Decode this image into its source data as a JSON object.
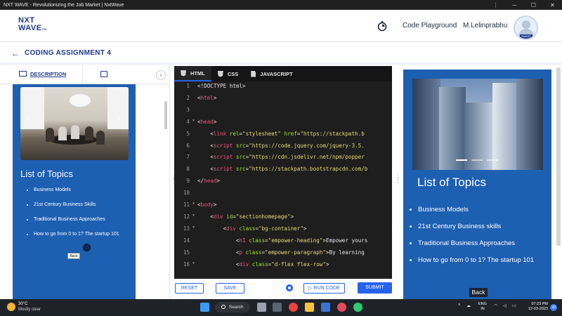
{
  "window": {
    "title": "NXT WAVE - Revolutionizing the Job Market | NxtWave",
    "controls": {
      "more": "⋮",
      "minimize": "─",
      "maximize": "☐",
      "close": "✕"
    }
  },
  "header": {
    "logo_line1": "NXT",
    "logo_line2": "WAVE",
    "logo_tm": "TM",
    "code_playground": "Code Playground",
    "user_name": "M.Lelinprabhu",
    "avatar_tag": "SMART"
  },
  "assignment": {
    "back_icon": "arrow-left-icon",
    "title": "CODING ASSIGNMENT 4"
  },
  "left_panel": {
    "tab_description": "DESCRIPTION",
    "collapse_icon": "‹",
    "preview": {
      "heading": "List of Topics",
      "topics": [
        "Business Models",
        "21st Century Business Skills",
        "Traditional Business Approaches",
        "How to go from 0 to 1? The startup 101"
      ],
      "back_button": "Back"
    }
  },
  "editor": {
    "tabs": [
      "HTML",
      "CSS",
      "JAVASCRIPT"
    ],
    "active_tab": "HTML",
    "lines": [
      {
        "n": "1",
        "fold": false,
        "tokens": [
          [
            "t",
            "<!DOCTYPE html>",
            "pun"
          ]
        ]
      },
      {
        "n": "2",
        "fold": false,
        "tokens": [
          [
            "t",
            "<",
            "pun"
          ],
          [
            "t",
            "html",
            "tag"
          ],
          [
            "t",
            ">",
            "pun"
          ]
        ]
      },
      {
        "n": "3",
        "fold": false,
        "tokens": []
      },
      {
        "n": "4",
        "fold": true,
        "tokens": [
          [
            "t",
            "<",
            "pun"
          ],
          [
            "t",
            "head",
            "tag"
          ],
          [
            "t",
            ">",
            "pun"
          ]
        ]
      },
      {
        "n": "5",
        "fold": false,
        "indent": "    ",
        "tokens": [
          [
            "t",
            "<",
            "pun"
          ],
          [
            "t",
            "link",
            "tag"
          ],
          [
            "t",
            " rel",
            "attr"
          ],
          [
            "t",
            "=",
            "pun"
          ],
          [
            "t",
            "\"stylesheet\"",
            "str"
          ],
          [
            "t",
            " href",
            "attr"
          ],
          [
            "t",
            "=",
            "pun"
          ],
          [
            "t",
            "\"https://stackpath.b",
            "str"
          ]
        ]
      },
      {
        "n": "6",
        "fold": false,
        "indent": "    ",
        "tokens": [
          [
            "t",
            "<",
            "pun"
          ],
          [
            "t",
            "script",
            "tag"
          ],
          [
            "t",
            " src",
            "attr"
          ],
          [
            "t",
            "=",
            "pun"
          ],
          [
            "t",
            "\"https://code.jquery.com/jquery-3.5.",
            "str"
          ]
        ]
      },
      {
        "n": "7",
        "fold": false,
        "indent": "    ",
        "tokens": [
          [
            "t",
            "<",
            "pun"
          ],
          [
            "t",
            "script",
            "tag"
          ],
          [
            "t",
            " src",
            "attr"
          ],
          [
            "t",
            "=",
            "pun"
          ],
          [
            "t",
            "\"https://cdn.jsdelivr.net/npm/popper",
            "str"
          ]
        ]
      },
      {
        "n": "8",
        "fold": false,
        "indent": "    ",
        "tokens": [
          [
            "t",
            "<",
            "pun"
          ],
          [
            "t",
            "script",
            "tag"
          ],
          [
            "t",
            " src",
            "attr"
          ],
          [
            "t",
            "=",
            "pun"
          ],
          [
            "t",
            "\"https://stackpath.bootstrapcdn.com/b",
            "str"
          ]
        ]
      },
      {
        "n": "9",
        "fold": false,
        "tokens": [
          [
            "t",
            "</",
            "pun"
          ],
          [
            "t",
            "head",
            "tag"
          ],
          [
            "t",
            ">",
            "pun"
          ]
        ]
      },
      {
        "n": "10",
        "fold": false,
        "tokens": []
      },
      {
        "n": "11",
        "fold": true,
        "tokens": [
          [
            "t",
            "<",
            "pun"
          ],
          [
            "t",
            "body",
            "tag"
          ],
          [
            "t",
            ">",
            "pun"
          ]
        ]
      },
      {
        "n": "12",
        "fold": true,
        "indent": "    ",
        "tokens": [
          [
            "t",
            "<",
            "pun"
          ],
          [
            "t",
            "div",
            "tag"
          ],
          [
            "t",
            " id",
            "attr"
          ],
          [
            "t",
            "=",
            "pun"
          ],
          [
            "t",
            "\"sectionhomepage\"",
            "str"
          ],
          [
            "t",
            ">",
            "pun"
          ]
        ]
      },
      {
        "n": "13",
        "fold": true,
        "indent": "        ",
        "tokens": [
          [
            "t",
            "<",
            "pun"
          ],
          [
            "t",
            "div",
            "tag"
          ],
          [
            "t",
            " class",
            "attr"
          ],
          [
            "t",
            "=",
            "pun"
          ],
          [
            "t",
            "\"bg-container\"",
            "str"
          ],
          [
            "t",
            ">",
            "pun"
          ]
        ]
      },
      {
        "n": "14",
        "fold": false,
        "indent": "            ",
        "tokens": [
          [
            "t",
            "<",
            "pun"
          ],
          [
            "t",
            "h1",
            "tag"
          ],
          [
            "t",
            " class",
            "attr"
          ],
          [
            "t",
            "=",
            "pun"
          ],
          [
            "t",
            "\"empower-heading\"",
            "str"
          ],
          [
            "t",
            ">Empower yours",
            "pun"
          ]
        ]
      },
      {
        "n": "15",
        "fold": false,
        "indent": "            ",
        "tokens": [
          [
            "t",
            "<",
            "pun"
          ],
          [
            "t",
            "p",
            "tag"
          ],
          [
            "t",
            " class",
            "attr"
          ],
          [
            "t",
            "=",
            "pun"
          ],
          [
            "t",
            "\"empower-paragraph\"",
            "str"
          ],
          [
            "t",
            ">By learning",
            "pun"
          ]
        ]
      },
      {
        "n": "16",
        "fold": true,
        "indent": "            ",
        "tokens": [
          [
            "t",
            "<",
            "pun"
          ],
          [
            "t",
            "div",
            "tag"
          ],
          [
            "t",
            " class",
            "attr"
          ],
          [
            "t",
            "=",
            "pun"
          ],
          [
            "t",
            "\"d-flex flex-row\"",
            "str"
          ],
          [
            "t",
            ">",
            "pun"
          ]
        ]
      }
    ],
    "buttons": {
      "reset": "RESET",
      "save": "SAVE",
      "run_code": "RUN CODE",
      "submit": "SUBMIT"
    }
  },
  "right_panel": {
    "heading": "List of Topics",
    "topics": [
      "Business Models",
      "21st Century Business skills",
      "Traditional Business Approaches",
      "How to go from 0 to 1? The startup 101"
    ],
    "back_button": "Back"
  },
  "taskbar": {
    "temperature": "30°C",
    "weather": "Mostly clear",
    "search_label": "Search",
    "language_line1": "ENG",
    "language_line2": "IN",
    "time": "07:23 PM",
    "date": "12-03-2023",
    "notification_count": "20"
  },
  "colors": {
    "brand_blue": "#1e3a8a",
    "accent_blue": "#2563eb",
    "preview_blue": "#1d5fb1",
    "editor_bg": "#1e1e1e"
  }
}
